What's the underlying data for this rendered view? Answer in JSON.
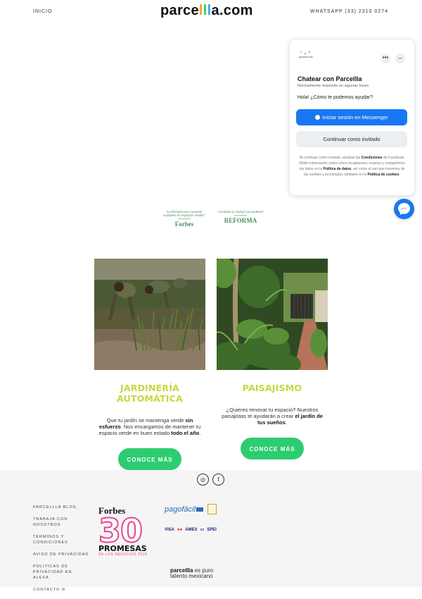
{
  "header": {
    "nav_left": "INICIO",
    "logo": {
      "p1": "parce",
      "p2": "l",
      "p3": "l",
      "p4": "l",
      "p5": "a",
      "p6": ".com"
    },
    "whatsapp": "WHATSAPP (33) 2310 0274"
  },
  "press": [
    {
      "quote": "\"La fórmula para convertir ciudades en espacios verdes\"",
      "brand": "Forbes"
    },
    {
      "quote": "\"Combina la ciudad con jardines\"",
      "brand": "REFORMA"
    }
  ],
  "services": [
    {
      "title": "JARDINERÍA AUTOMÁTICA",
      "desc_1": "Que tu jardín se mantenga verde ",
      "desc_b1": "sin esfuerzo",
      "desc_2": ". Nos encargamos de mantener tu espacio verde en buen estado ",
      "desc_b2": "todo el año",
      "desc_3": ".",
      "button": "CONOCE MÁS"
    },
    {
      "title": "PAISAJISMO",
      "desc_1": "¿Quieres renovar tu espacio? Nuestros paisajistas te ayudarán a crear ",
      "desc_b1": "el jardín de tus sueños",
      "desc_3": ".",
      "button": "CONOCE MÁS"
    }
  ],
  "footer": {
    "social": [
      {
        "icon": "instagram-icon",
        "glyph": "◎"
      },
      {
        "icon": "facebook-icon",
        "glyph": "f"
      }
    ],
    "links": [
      "PARCELLLA BLOG",
      "TRABAJA CON NOSOTROS",
      "TÉRMINOS Y CONDICIONES",
      "AVISO DE PRIVACIDAD",
      "POLITICAS DE PRIVACIDAD EN ALEXA",
      "CONTACTO"
    ],
    "forbes30": {
      "brand": "Forbes",
      "number": "30",
      "promesas": "PROMESAS",
      "sub": "DE LOS NEGOCIOS 2018"
    },
    "pagofacil": "pagofácil",
    "cards": [
      "VISA",
      "●●",
      "AMEX",
      "▭",
      "SPEI"
    ],
    "tagline_b": "parcellla",
    "tagline_1": " es puro",
    "tagline_2": "talento mexicano"
  },
  "chat": {
    "logo_text": "parcellla.com",
    "title": "Chatear con Parcellla",
    "subtitle": "Normalmente responde en algunas horas",
    "question": "Hola! ¿Cómo te podemos ayudar?",
    "btn_login": "Iniciar sesión en Messenger",
    "btn_guest": "Continuar como invitado",
    "legal_1": "Al continuar como invitado, aceptas las ",
    "legal_b1": "Condiciones",
    "legal_2": " de Facebook. Obtén información sobre cómo recopilamos, usamos y compartimos tus datos en la ",
    "legal_b2": "Política de datos",
    "legal_3": ", así como el uso que hacemos de las cookies y tecnologías similares en la ",
    "legal_b3": "Política de cookies",
    "legal_4": "."
  },
  "colors": {
    "green": "#2ecc71",
    "lime_title": "#c8d640",
    "messenger_blue": "#1877f2",
    "pink": "#e84393"
  }
}
